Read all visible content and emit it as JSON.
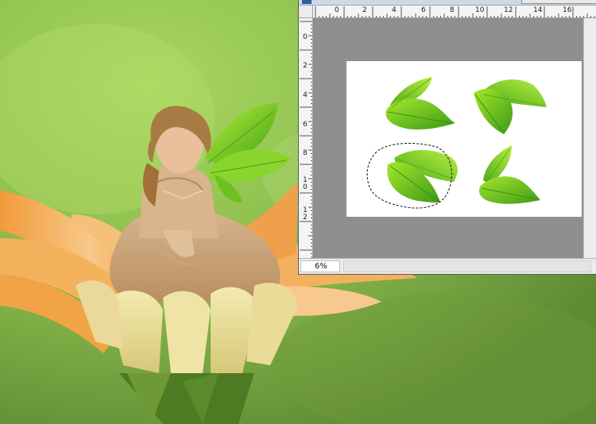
{
  "document": {
    "zoom_label": "6%"
  },
  "ruler_top": {
    "labels": [
      "0",
      "2",
      "4",
      "6",
      "8",
      "10",
      "12",
      "14",
      "16"
    ]
  },
  "ruler_left": {
    "labels": [
      "0",
      "2",
      "4",
      "6",
      "8",
      "1 0",
      "1 2"
    ]
  },
  "colors": {
    "canvas_gray": "#8f8f8f",
    "leaf_light": "#9be12b",
    "leaf_dark": "#3a9a16",
    "background_green": "#8fbe4a"
  },
  "icons": {
    "leaf_icon": "leaf",
    "selection_marquee": "lasso-selection"
  }
}
